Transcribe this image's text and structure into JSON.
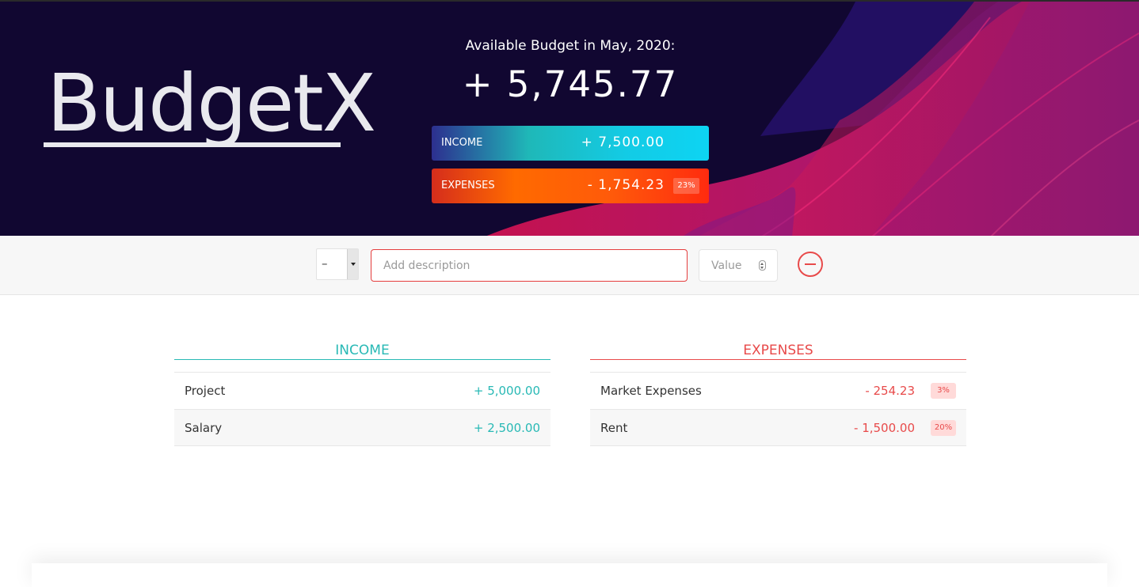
{
  "app": {
    "logo_text": "BudgetX"
  },
  "budget": {
    "title": "Available Budget in May, 2020:",
    "value": "+ 5,745.77"
  },
  "summary": {
    "income": {
      "label": "Income",
      "value": "+ 7,500.00"
    },
    "expenses": {
      "label": "Expenses",
      "value": "- 1,754.23",
      "percentage": "23%"
    }
  },
  "add_form": {
    "type_value": "–",
    "description_placeholder": "Add description",
    "value_placeholder": "Value",
    "add_button_icon": "minus-circle-icon"
  },
  "lists": {
    "income": {
      "title": "Income",
      "items": [
        {
          "description": "Project",
          "value": "+ 5,000.00"
        },
        {
          "description": "Salary",
          "value": "+ 2,500.00"
        }
      ]
    },
    "expenses": {
      "title": "Expenses",
      "items": [
        {
          "description": "Market Expenses",
          "value": "- 254.23",
          "percentage": "3%"
        },
        {
          "description": "Rent",
          "value": "- 1,500.00",
          "percentage": "20%"
        }
      ]
    }
  },
  "colors": {
    "income": "#28b9b5",
    "expenses": "#e84a4a",
    "banner_bg": "#110731"
  }
}
